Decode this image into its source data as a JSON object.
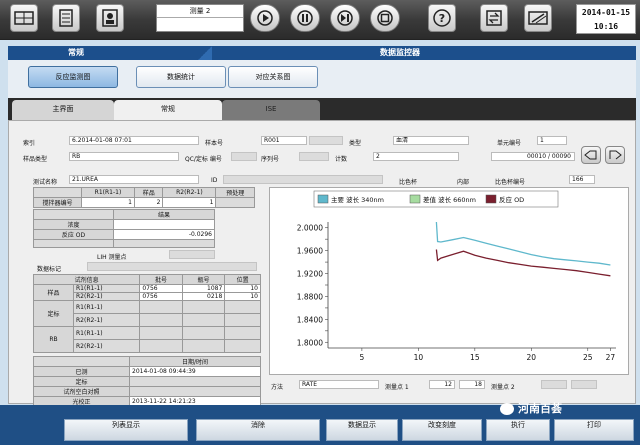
{
  "toolbar": {
    "measure_label": "测量 2",
    "date": "2014-01-15",
    "time": "10:16"
  },
  "title": {
    "left": "常规",
    "right": "数据监控器"
  },
  "nav": [
    "反应监测图",
    "数据统计",
    "对应关系图"
  ],
  "tabs": [
    "主界面",
    "常规",
    "ISE"
  ],
  "info": {
    "sample_id_label": "索引",
    "sample_id": "6.2014-01-08 07:01",
    "sample_no_label": "样本号",
    "sample_no": "R001",
    "type_label": "类型",
    "type": "血清",
    "cup_label": "单元编号",
    "cup": "1",
    "sample_type_label": "样品类型",
    "sample_type": "RB",
    "qc_label": "QC/定标 编号",
    "seq_label": "序列号",
    "count_label": "计数",
    "count": "2",
    "counter": "00010 / 00090"
  },
  "test": {
    "name_label": "测试名称",
    "name": "21.UREA",
    "id_label": "ID",
    "ratio_label": "比色杯",
    "inner_label": "内部",
    "ratio_no_label": "比色杯编号",
    "ratio_no": "166"
  },
  "reagent_header": [
    "R1(R1-1)",
    "样品",
    "R2(R2-1)",
    "预处理"
  ],
  "reagent_row_label": "搅拌器编号",
  "reagent_row": [
    "1",
    "2",
    "1",
    ""
  ],
  "result": {
    "header": "结果",
    "conc_label": "浓度",
    "od_label": "反应 OD",
    "od_value": "-0.0296",
    "lih_label": "LIH 测量点",
    "flag_label": "数据标记"
  },
  "lot": {
    "headers": [
      "试剂信息",
      "批号",
      "瓶号",
      "位置"
    ],
    "rows": [
      {
        "group": "样品",
        "name": "R1(R1-1)",
        "lot": "0756",
        "bottle": "1087",
        "pos": "10"
      },
      {
        "group": "",
        "name": "R2(R2-1)",
        "lot": "0756",
        "bottle": "0218",
        "pos": "10"
      },
      {
        "group": "定标",
        "name": "R1(R1-1)",
        "lot": "",
        "bottle": "",
        "pos": ""
      },
      {
        "group": "",
        "name": "R2(R2-1)",
        "lot": "",
        "bottle": "",
        "pos": ""
      },
      {
        "group": "RB",
        "name": "R1(R1-1)",
        "lot": "",
        "bottle": "",
        "pos": ""
      },
      {
        "group": "",
        "name": "R2(R2-1)",
        "lot": "",
        "bottle": "",
        "pos": ""
      }
    ]
  },
  "dates": {
    "header": "日期/时间",
    "rows": [
      {
        "label": "已测",
        "value": "2014-01-08 09:44:39"
      },
      {
        "label": "定标",
        "value": ""
      },
      {
        "label": "试剂空白对照",
        "value": ""
      },
      {
        "label": "光校正",
        "value": "2013-11-22 14:21:23"
      }
    ]
  },
  "method": {
    "method_label": "方法",
    "method": "RATE",
    "point1_label": "测量点 1",
    "point1a": "12",
    "point1b": "18",
    "point2_label": "测量点 2"
  },
  "chart_data": {
    "type": "line",
    "legend": [
      "主要 波长 340nm",
      "差值 波长 660nm",
      "反应 OD"
    ],
    "colors": [
      "#5fb8cc",
      "#a6dca0",
      "#7a1f2e"
    ],
    "x_ticks": [
      5,
      10,
      15,
      20,
      25,
      27
    ],
    "y_ticks": [
      2.0,
      1.98,
      1.96,
      1.94,
      1.92,
      1.9,
      1.88,
      1.86,
      1.84,
      1.82,
      1.8
    ],
    "y_tick_labels": [
      "2.0000",
      "1.9800",
      "1.9600",
      "1.9400",
      "1.9200",
      "1.9000",
      "1.8800",
      "1.8600",
      "1.8400",
      "1.8200",
      "1.8000"
    ],
    "xlim": [
      2,
      27.5
    ],
    "ylim": [
      1.79,
      2.01
    ],
    "series": [
      {
        "name": "主要 波长 340nm",
        "x": [
          11.6,
          11.7,
          12,
          13,
          14,
          15,
          16,
          17,
          18,
          19,
          20,
          21,
          22,
          23,
          24,
          25,
          26,
          27
        ],
        "values": [
          2.01,
          1.976,
          1.975,
          1.979,
          1.983,
          1.978,
          1.973,
          1.968,
          1.963,
          1.958,
          1.953,
          1.949,
          1.946,
          1.944,
          1.942,
          1.94,
          1.938,
          1.935
        ]
      },
      {
        "name": "反应 OD",
        "x": [
          11.6,
          11.7,
          12,
          13,
          14,
          15,
          16,
          17,
          18,
          19,
          20,
          21,
          22,
          23,
          24,
          25,
          26,
          27
        ],
        "values": [
          1.962,
          1.943,
          1.947,
          1.953,
          1.959,
          1.952,
          1.947,
          1.943,
          1.939,
          1.936,
          1.933,
          1.931,
          1.929,
          1.927,
          1.925,
          1.922,
          1.919,
          1.916
        ]
      }
    ]
  },
  "bottom": [
    "列表显示",
    "消除",
    "数据显示",
    "改变刻度",
    "执行",
    "打印"
  ],
  "watermark": "河南百荟"
}
